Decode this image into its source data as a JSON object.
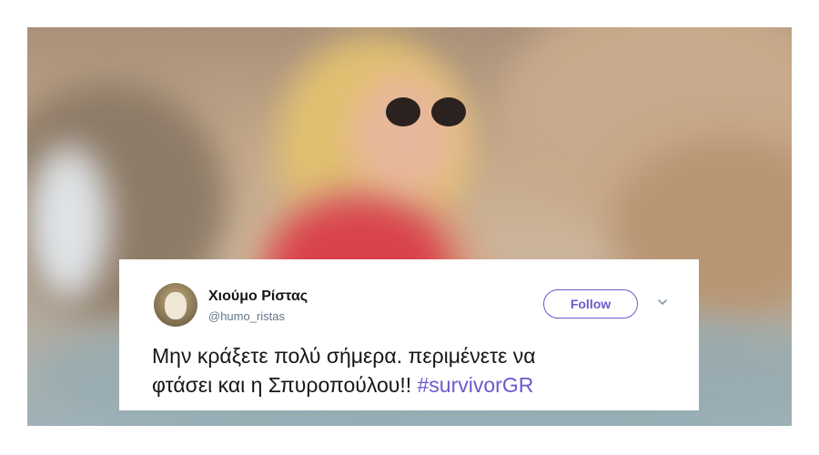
{
  "tweet": {
    "name": "Χιούμο Ρίστας",
    "handle": "@humo_ristas",
    "follow_label": "Follow",
    "text_line1": "Μην κράξετε πολύ σήμερα. περιμένετε να",
    "text_line2": "φτάσει και η Σπυροπούλου!!",
    "hashtag": "#survivorGR"
  },
  "icons": {
    "avatar": "dog-avatar",
    "more": "chevron-down-icon"
  },
  "colors": {
    "accent": "#6a5acd",
    "text": "#14171a",
    "muted": "#657786"
  }
}
